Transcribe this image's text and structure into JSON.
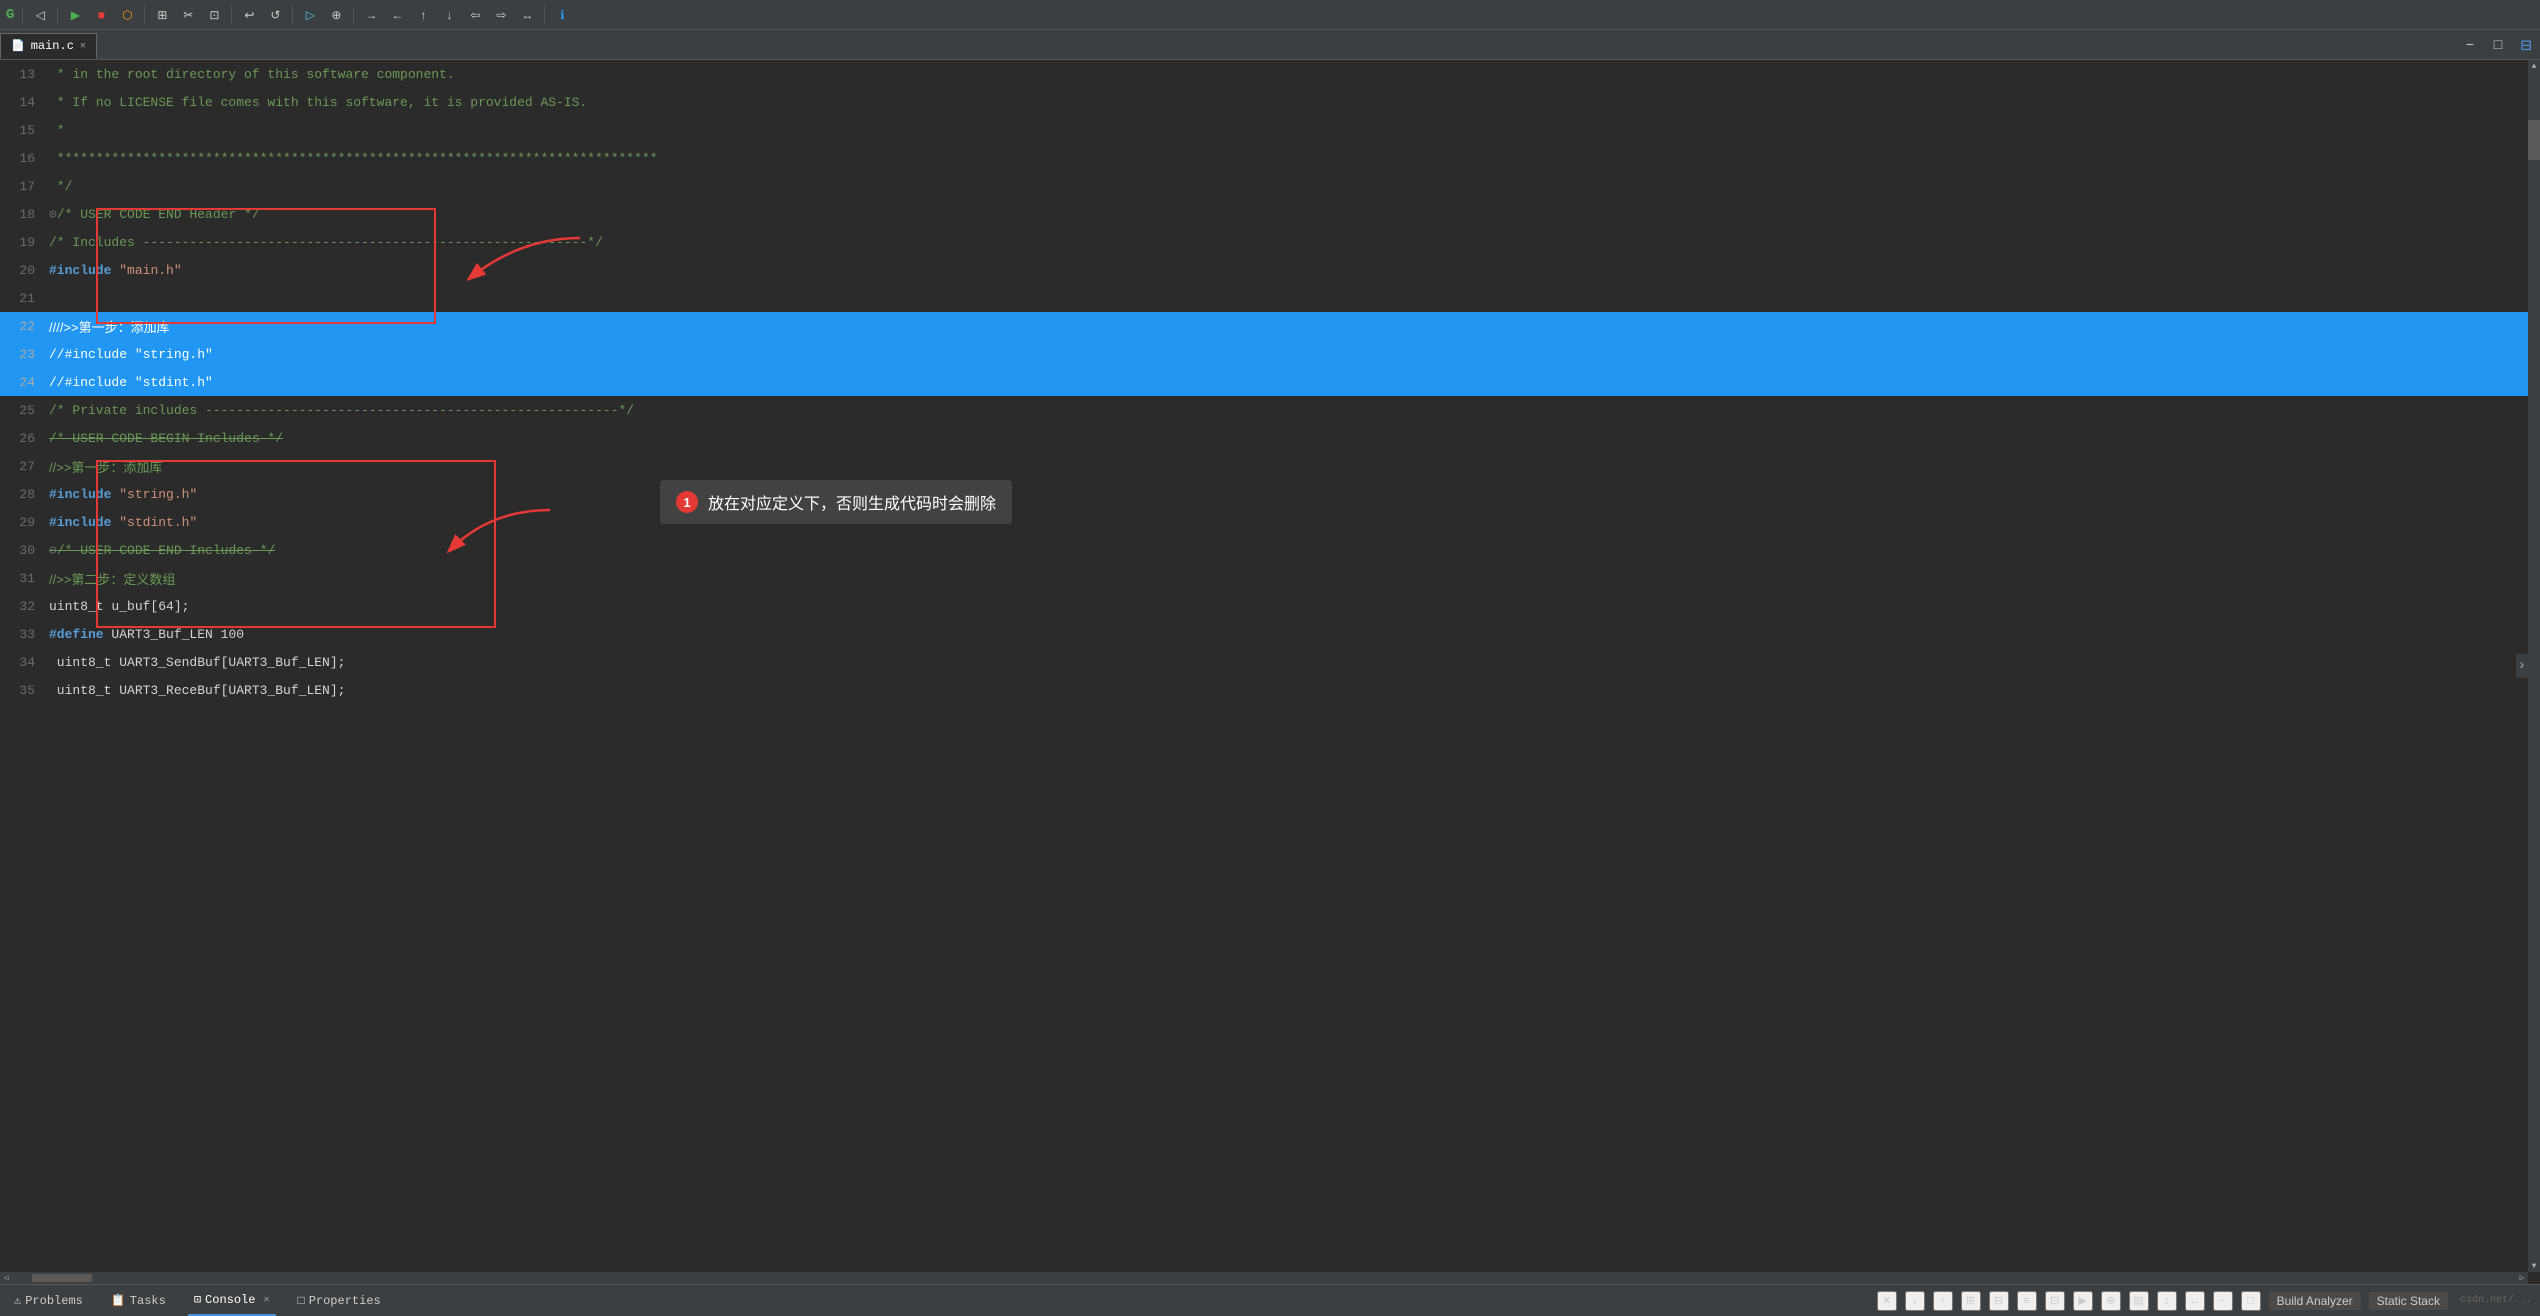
{
  "toolbar": {
    "buttons": [
      "G",
      "←",
      "▶",
      "■",
      "⬡",
      "⇒",
      "✎",
      "✂",
      "⊞",
      "↩",
      "↺",
      "▷",
      "⊕",
      "→",
      "←",
      "↑",
      "↓",
      "⇦",
      "⇨",
      "↔",
      "ℹ"
    ]
  },
  "tab": {
    "icon": "📄",
    "filename": "main.c",
    "close": "✕",
    "active": true
  },
  "lines": [
    {
      "num": "13",
      "text": " * in the root directory of this software component.",
      "classes": "c-green"
    },
    {
      "num": "14",
      "text": " * If no LICENSE file comes with this software, it is provided AS-IS.",
      "classes": "c-green"
    },
    {
      "num": "15",
      "text": " *",
      "classes": "c-green"
    },
    {
      "num": "16",
      "text": " *****************************************************************************",
      "classes": "c-green"
    },
    {
      "num": "17",
      "text": " */",
      "classes": "c-green"
    },
    {
      "num": "18",
      "text": "⊙/* USER CODE END Header */",
      "special": "user-code-end",
      "classes": "c-green"
    },
    {
      "num": "19",
      "text": "/* Includes ---------------------------------------------------------*/",
      "classes": "c-green"
    },
    {
      "num": "20",
      "text": "#include \"main.h\"",
      "special": "include",
      "classes": ""
    },
    {
      "num": "21",
      "text": "",
      "classes": ""
    },
    {
      "num": "22",
      "text": "////>>第一步：添加库",
      "highlighted": true,
      "classes": "c-highlighted-text"
    },
    {
      "num": "23",
      "text": "//#include \"string.h\"",
      "highlighted": true,
      "classes": "c-highlighted-text"
    },
    {
      "num": "24",
      "text": "//#include \"stdint.h\"",
      "highlighted": true,
      "classes": "c-highlighted-text"
    },
    {
      "num": "25",
      "text": "/* Private includes -----------------------------------------------------*/",
      "classes": "c-green"
    },
    {
      "num": "26",
      "text": "/* USER CODE BEGIN Includes */",
      "strikethrough": true,
      "classes": "c-green"
    },
    {
      "num": "27",
      "text": "//>>第一步：添加库",
      "classes": "c-green"
    },
    {
      "num": "28",
      "text": "#include \"string.h\"",
      "special": "include2",
      "classes": ""
    },
    {
      "num": "29",
      "text": "#include \"stdint.h\"",
      "special": "include3",
      "classes": ""
    },
    {
      "num": "30",
      "text": "⊙/* USER CODE END Includes */",
      "strikethrough": true,
      "classes": "c-green"
    },
    {
      "num": "31",
      "text": "//>>第二步：定义数组",
      "classes": "c-green"
    },
    {
      "num": "32",
      "text": "uint8_t u_buf[64];",
      "classes": "c-white"
    },
    {
      "num": "33",
      "text": "#define UART3_Buf_LEN 100",
      "special": "define",
      "classes": ""
    },
    {
      "num": "34",
      "text": " uint8_t UART3_SendBuf[UART3_Buf_LEN];",
      "classes": "c-white"
    },
    {
      "num": "35",
      "text": " uint8_t UART3_ReceBuf[UART3_Buf_LEN];",
      "classes": "c-white"
    }
  ],
  "tooltip": {
    "num": "1",
    "text": "放在对应定义下，否则生成代码时会删除"
  },
  "annotations": {
    "top_box_label": "CODE",
    "includes_label": "Includes"
  },
  "bottom_bar": {
    "tabs": [
      "Problems",
      "Tasks",
      "Console",
      "Properties"
    ],
    "active_tab": "Console",
    "right_buttons": [
      "✕",
      "↓",
      "↑",
      "⊞",
      "⊟",
      "≡",
      "⊡",
      "▶",
      "⊕",
      "▤",
      "↕",
      "↔",
      "−",
      "□"
    ],
    "build_analyzer": "Build Analyzer",
    "static_stack": "Static Stack"
  }
}
